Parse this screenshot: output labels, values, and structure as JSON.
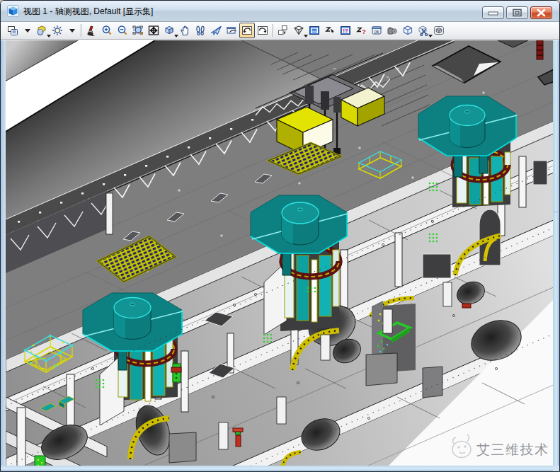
{
  "window": {
    "title": "视图 1 - 轴测视图, Default [显示集]",
    "icon": "view-window-cube-icon",
    "controls": [
      {
        "name": "minimize",
        "glyph": "dash"
      },
      {
        "name": "restore",
        "glyph": "box-in-box"
      },
      {
        "name": "close",
        "glyph": "x"
      }
    ]
  },
  "toolbar": {
    "items": [
      {
        "icon": "view-attributes-icon",
        "dropdown": "right"
      },
      {
        "icon": "display-style-icon",
        "dropdown": "mini"
      },
      {
        "icon": "adjust-lighting-icon",
        "dropdown": "right"
      },
      {
        "separator": true
      },
      {
        "icon": "update-view-brush-icon"
      },
      {
        "icon": "zoom-in-icon"
      },
      {
        "icon": "zoom-out-icon"
      },
      {
        "icon": "window-area-icon"
      },
      {
        "icon": "fit-view-icon"
      },
      {
        "icon": "rotate-view-cube-icon",
        "dropdown": "mini"
      },
      {
        "icon": "pan-view-hand-icon"
      },
      {
        "icon": "walk-footprints-icon"
      },
      {
        "icon": "fly-plane-icon"
      },
      {
        "icon": "navigate-view-icon"
      },
      {
        "icon": "view-previous-icon",
        "selected": true
      },
      {
        "icon": "view-next-icon"
      },
      {
        "separator": true
      },
      {
        "icon": "copy-view-icon"
      },
      {
        "icon": "clip-volume-funnel-icon",
        "dropdown": "mini"
      },
      {
        "icon": "apply-display-set-icon"
      },
      {
        "icon": "set-display-depth-icon"
      },
      {
        "icon": "show-display-set-icon"
      },
      {
        "icon": "show-display-depth-icon"
      },
      {
        "icon": "dialog-ok-icon"
      },
      {
        "icon": "define-camera-icon"
      },
      {
        "icon": "cube-wireframe-icon"
      },
      {
        "icon": "clip-cube-scissors-icon",
        "dropdown": "mini"
      },
      {
        "icon": "cube-in-box-icon"
      }
    ]
  },
  "viewport": {
    "watermark": {
      "logo": "mascot-sketch-icon",
      "text": "艾三维技术"
    },
    "scene": {
      "description": "isometric cutaway CAD model of a ship engine-room block: sloped hull plating upper-left, crane rail deck, main deck with hatch gratings, three teal scavenge-air receivers on octagonal platforms, cylinder liners, lower engine decks",
      "colors": {
        "teal": "#0d8181",
        "teal_dark": "#086868",
        "teal_light": "#14a2a2",
        "cyan_edge": "#00e0e0",
        "deck_gray": "#7f7f7f",
        "deck_dark": "#4c4c4c",
        "wall_light": "#c9c9c9",
        "wall_mid": "#9b9b9b",
        "white": "#ffffff",
        "yellow": "#e0e000",
        "yellow_dark": "#9e9e00",
        "grating_blue": "#1c1c66",
        "maroon": "#5c1414",
        "green": "#22cc22",
        "red": "#cc2200",
        "outline": "#101010"
      }
    }
  }
}
